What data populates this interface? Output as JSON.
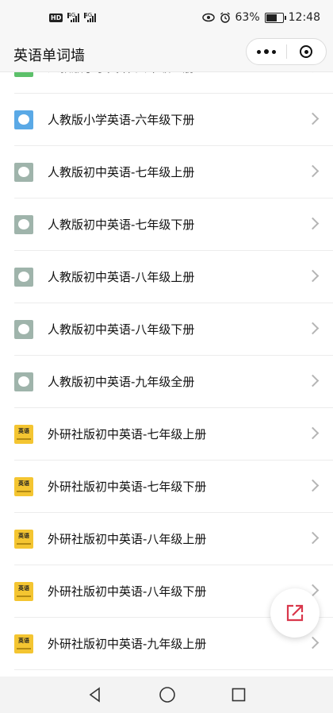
{
  "status_bar": {
    "hd_badge": "HD",
    "network_1": "4G",
    "network_2": "4G",
    "battery_percent": "63%",
    "time": "12:48"
  },
  "nav": {
    "title": "英语单词墙"
  },
  "books": [
    {
      "label": "人教版小学英语-六年级上册",
      "cover": "green"
    },
    {
      "label": "人教版小学英语-六年级下册",
      "cover": "blue"
    },
    {
      "label": "人教版初中英语-七年级上册",
      "cover": "gray"
    },
    {
      "label": "人教版初中英语-七年级下册",
      "cover": "gray"
    },
    {
      "label": "人教版初中英语-八年级上册",
      "cover": "gray"
    },
    {
      "label": "人教版初中英语-八年级下册",
      "cover": "gray"
    },
    {
      "label": "人教版初中英语-九年级全册",
      "cover": "gray"
    },
    {
      "label": "外研社版初中英语-七年级上册",
      "cover": "yellow"
    },
    {
      "label": "外研社版初中英语-七年级下册",
      "cover": "yellow"
    },
    {
      "label": "外研社版初中英语-八年级上册",
      "cover": "yellow"
    },
    {
      "label": "外研社版初中英语-八年级下册",
      "cover": "yellow"
    },
    {
      "label": "外研社版初中英语-九年级上册",
      "cover": "yellow"
    }
  ],
  "cover_text": {
    "yellow": "英语"
  },
  "colors": {
    "share_accent": "#d9374b",
    "bar_bg": "#f7f7f7"
  }
}
